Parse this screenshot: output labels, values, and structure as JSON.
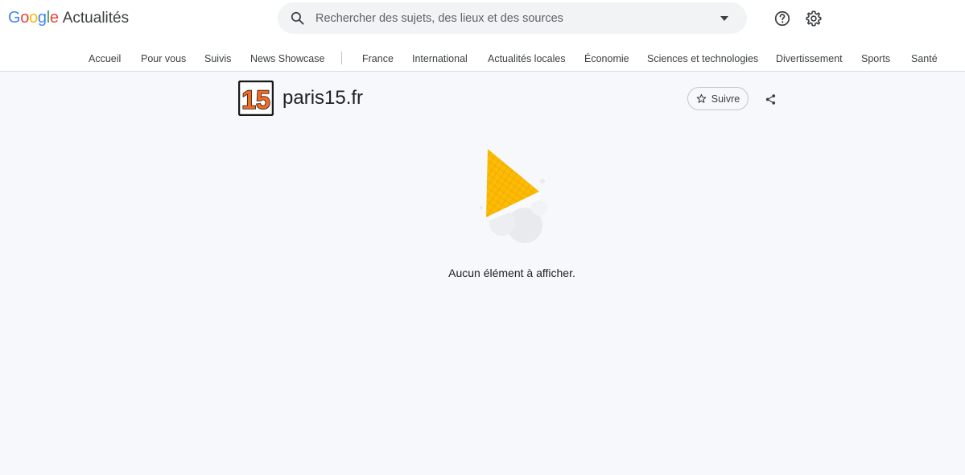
{
  "header": {
    "brand": {
      "letters": [
        {
          "char": "G",
          "color": "#4285F4"
        },
        {
          "char": "o",
          "color": "#EA4335"
        },
        {
          "char": "o",
          "color": "#FBBC05"
        },
        {
          "char": "g",
          "color": "#4285F4"
        },
        {
          "char": "l",
          "color": "#34A853"
        },
        {
          "char": "e",
          "color": "#EA4335"
        }
      ],
      "product": "Actualités"
    },
    "search": {
      "placeholder": "Rechercher des sujets, des lieux et des sources",
      "value": "",
      "icon": "search-icon",
      "dropdown_icon": "caret-down-icon"
    },
    "icons": [
      "help-icon",
      "settings-icon"
    ]
  },
  "nav": {
    "items": [
      "Accueil",
      "Pour vous",
      "Suivis",
      "News Showcase",
      "France",
      "International",
      "Actualités locales",
      "Économie",
      "Sciences et technologies",
      "Divertissement",
      "Sports",
      "Santé"
    ]
  },
  "source": {
    "logo_text": "15",
    "logo_color": "#f26b21",
    "title": "paris15.fr",
    "follow_label": "Suivre",
    "follow_icon": "star-outline-icon",
    "share_icon": "share-icon"
  },
  "empty_state": {
    "message": "Aucun élément à afficher."
  }
}
